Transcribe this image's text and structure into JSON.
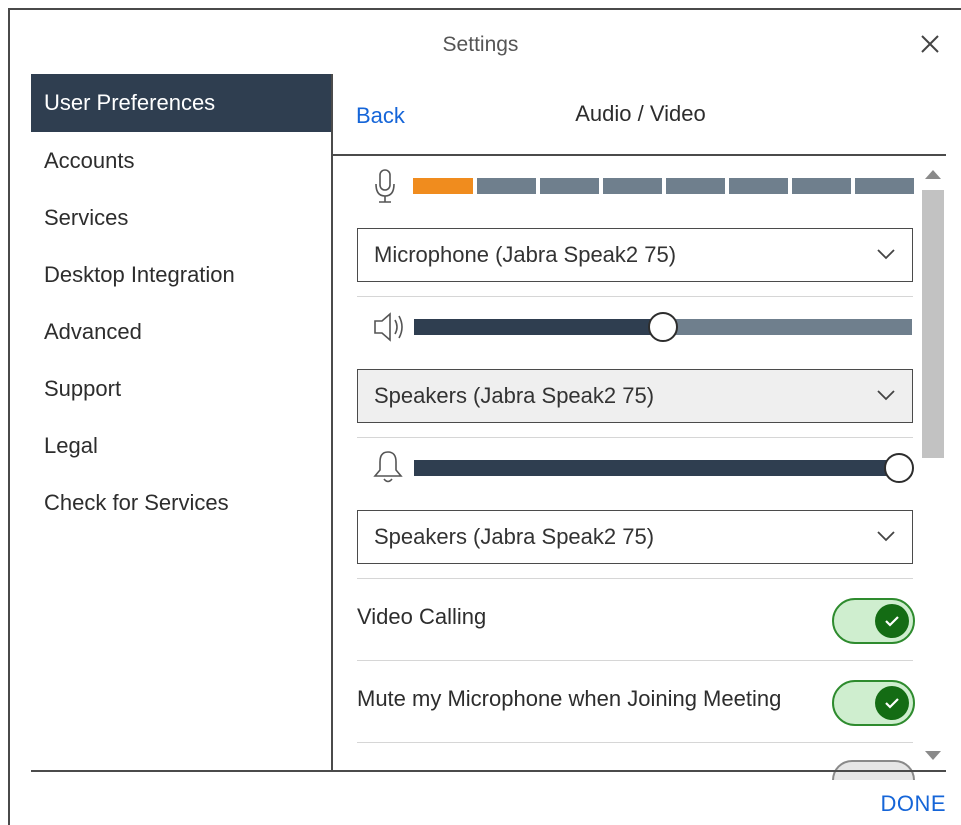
{
  "window": {
    "title": "Settings"
  },
  "sidebar": {
    "items": [
      {
        "label": "User Preferences",
        "active": true
      },
      {
        "label": "Accounts"
      },
      {
        "label": "Services"
      },
      {
        "label": "Desktop Integration"
      },
      {
        "label": "Advanced"
      },
      {
        "label": "Support"
      },
      {
        "label": "Legal"
      },
      {
        "label": "Check for Services"
      }
    ]
  },
  "panel": {
    "back_label": "Back",
    "title": "Audio / Video",
    "mic_level": {
      "active_segments": 1,
      "total_segments": 8
    },
    "microphone_select": {
      "value": "Microphone (Jabra Speak2 75)"
    },
    "speaker_volume": {
      "level": 0.5
    },
    "speakers_select": {
      "value": "Speakers (Jabra Speak2 75)"
    },
    "ringer_volume": {
      "level": 1.0
    },
    "ringer_select": {
      "value": "Speakers (Jabra Speak2 75)"
    },
    "video_calling": {
      "label": "Video Calling",
      "on": true
    },
    "mute_on_join": {
      "label": "Mute my Microphone when Joining Meeting",
      "on": true
    }
  },
  "footer": {
    "done_label": "DONE"
  },
  "colors": {
    "accent": "#1565d8",
    "sidebar_active": "#2f3e50",
    "meter_active": "#f08c1e",
    "toggle_on": "#146c14"
  }
}
